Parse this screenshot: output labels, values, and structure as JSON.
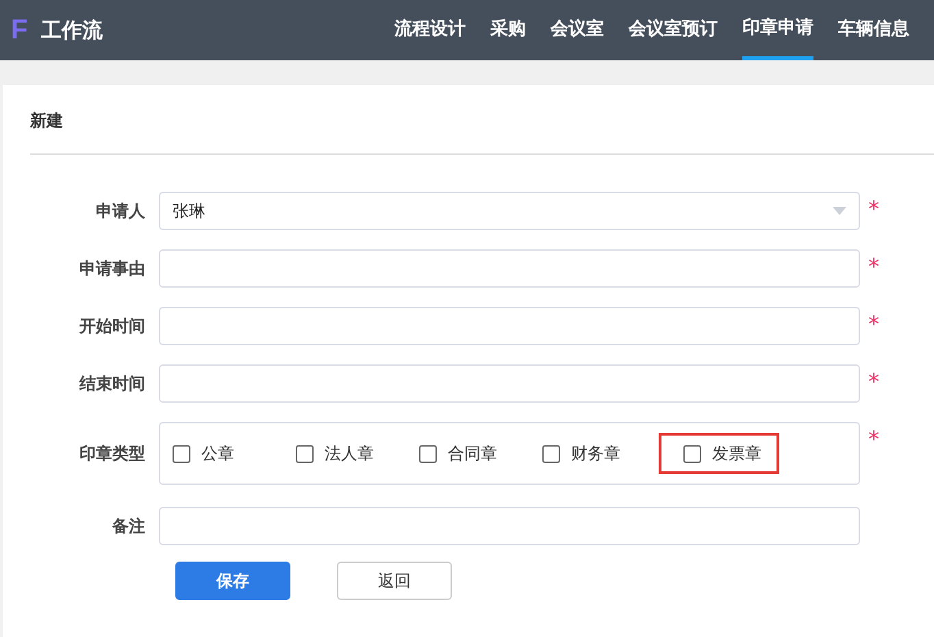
{
  "header": {
    "logo": "F",
    "title": "工作流",
    "nav": [
      {
        "label": "流程设计",
        "selected": false
      },
      {
        "label": "采购",
        "selected": false
      },
      {
        "label": "会议室",
        "selected": false
      },
      {
        "label": "会议室预订",
        "selected": false
      },
      {
        "label": "印章申请",
        "selected": true
      },
      {
        "label": "车辆信息",
        "selected": false
      }
    ]
  },
  "card": {
    "title": "新建",
    "fields": [
      {
        "kind": "select",
        "label": "申请人",
        "value": "张琳",
        "required_mark": "*"
      },
      {
        "kind": "text",
        "label": "申请事由",
        "required_mark": "*"
      },
      {
        "kind": "text",
        "label": "开始时间",
        "required_mark": "*"
      },
      {
        "kind": "text",
        "label": "结束时间",
        "required_mark": "*"
      },
      {
        "kind": "checkboxes",
        "label": "印章类型",
        "required_mark": "*",
        "options": [
          {
            "label": "公章",
            "checked": false,
            "highlighted": false
          },
          {
            "label": "法人章",
            "checked": false,
            "highlighted": false
          },
          {
            "label": "合同章",
            "checked": false,
            "highlighted": false
          },
          {
            "label": "财务章",
            "checked": false,
            "highlighted": false
          },
          {
            "label": "发票章",
            "checked": false,
            "highlighted": true
          }
        ]
      },
      {
        "kind": "text",
        "label": "备注"
      }
    ],
    "buttons": [
      {
        "kind": "primary",
        "label": "保存"
      },
      {
        "kind": "default",
        "label": "返回"
      }
    ]
  }
}
